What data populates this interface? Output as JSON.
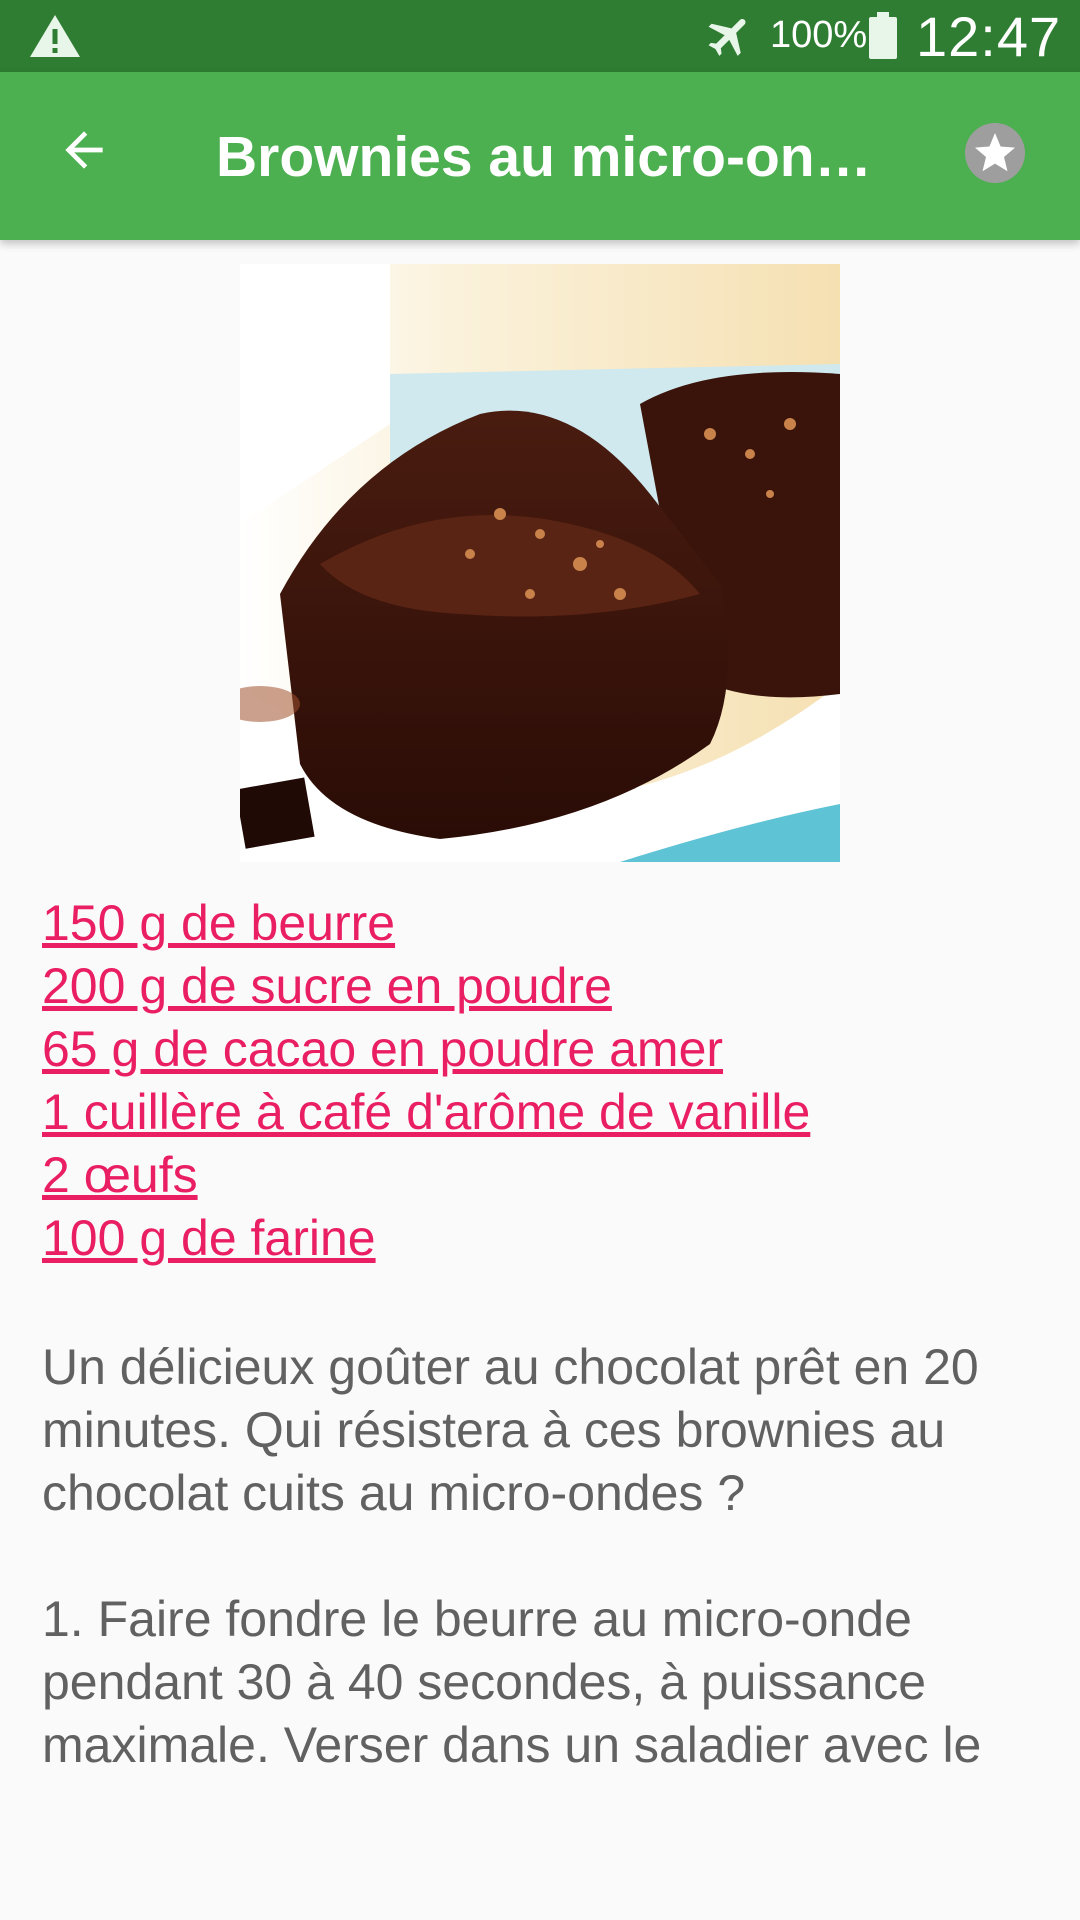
{
  "status_bar": {
    "battery": "100%",
    "time": "12:47",
    "icons": [
      "warning-icon",
      "airplane-mode-icon",
      "battery-icon"
    ]
  },
  "app_bar": {
    "title": "Brownies au micro-ondes",
    "back_icon": "arrow-left-icon",
    "favorite_icon": "star-icon",
    "background": "#4caf50",
    "status_background": "#2e7d32"
  },
  "recipe": {
    "image": "brownies-photo",
    "ingredients": [
      "150 g de beurre",
      "200 g de sucre en poudre",
      "65 g de cacao en poudre amer",
      "1 cuillère à café d'arôme de vanille",
      "2 œufs",
      "100 g de farine"
    ],
    "ingredient_color": "#e91e63",
    "description": "Un délicieux goûter au chocolat prêt en 20 minutes. Qui résistera à ces brownies au chocolat cuits au micro-ondes ?",
    "instructions": "1. Faire fondre le beurre au micro-onde pendant 30 à 40 secondes, à puissance maximale. Verser dans un saladier avec le"
  }
}
